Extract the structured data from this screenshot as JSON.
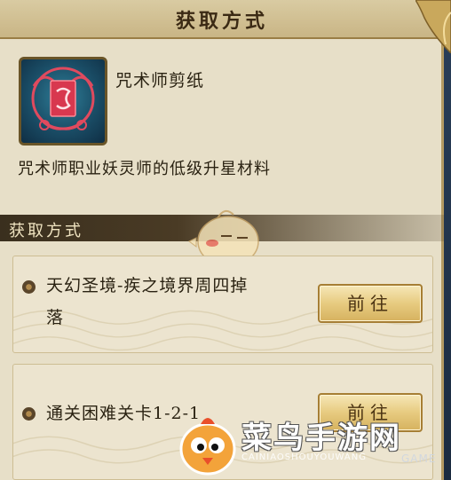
{
  "dialog": {
    "title": "获取方式"
  },
  "item": {
    "name": "咒术师剪纸",
    "description": "咒术师职业妖灵师的低级升星材料",
    "icon": "paper-cut-talisman-icon"
  },
  "section": {
    "label": "获取方式"
  },
  "sources": [
    {
      "line1": "天幻圣境-疾之境界周四掉",
      "line2": "落",
      "button_label": "前往"
    },
    {
      "line1": "通关困难关卡1-2-1",
      "line2": "",
      "button_label": "前往"
    }
  ],
  "watermark": {
    "brand": "菜鸟手游网",
    "sub": "CAINIAOSHOUYOUWANG",
    "overlay": "GAME"
  },
  "colors": {
    "panel": "#e7dfc8",
    "button_gold": "#e7cb80",
    "dark_bar": "#3a2f1e",
    "frame": "#1d2e44"
  }
}
